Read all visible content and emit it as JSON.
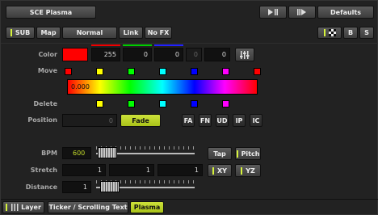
{
  "header": {
    "title": "SCE Plasma",
    "defaults_label": "Defaults"
  },
  "toolbar": {
    "sub": "SUB",
    "map": "Map",
    "blend": "Normal",
    "link": "Link",
    "nofx": "No FX",
    "b": "B",
    "s": "S"
  },
  "color": {
    "label": "Color",
    "value_r": "255",
    "value_g": "0",
    "value_b": "0",
    "value_w": "0",
    "value_a": "0",
    "swatch_hex": "#ff0000"
  },
  "move": {
    "label": "Move",
    "swatches": [
      "#ff0000",
      "#ffff00",
      "#00ff00",
      "#00ffff",
      "#0000ff",
      "#ff00ff",
      "#ff0000"
    ],
    "gradient_value": "0.000"
  },
  "delete": {
    "label": "Delete",
    "swatches": [
      "#ffff00",
      "#00ff00",
      "#00ffff",
      "#0000ff",
      "#ff00ff"
    ]
  },
  "position": {
    "label": "Position",
    "value": "0",
    "fade_label": "Fade",
    "modes": [
      "FA",
      "FN",
      "UD",
      "IP",
      "IC"
    ]
  },
  "bpm": {
    "label": "BPM",
    "value": "600",
    "tap_label": "Tap",
    "pitch_label": "Pitch"
  },
  "stretch": {
    "label": "Stretch",
    "values": [
      "1",
      "1",
      "1"
    ],
    "xy_label": "XY",
    "yz_label": "YZ"
  },
  "distance": {
    "label": "Distance",
    "value": "1"
  },
  "footer": {
    "layer_label": "Layer",
    "tabs": [
      "Ticker / Scrolling Text",
      "Plasma"
    ]
  },
  "colors": {
    "accent": "#c4dc2a",
    "panel": "#222222"
  }
}
